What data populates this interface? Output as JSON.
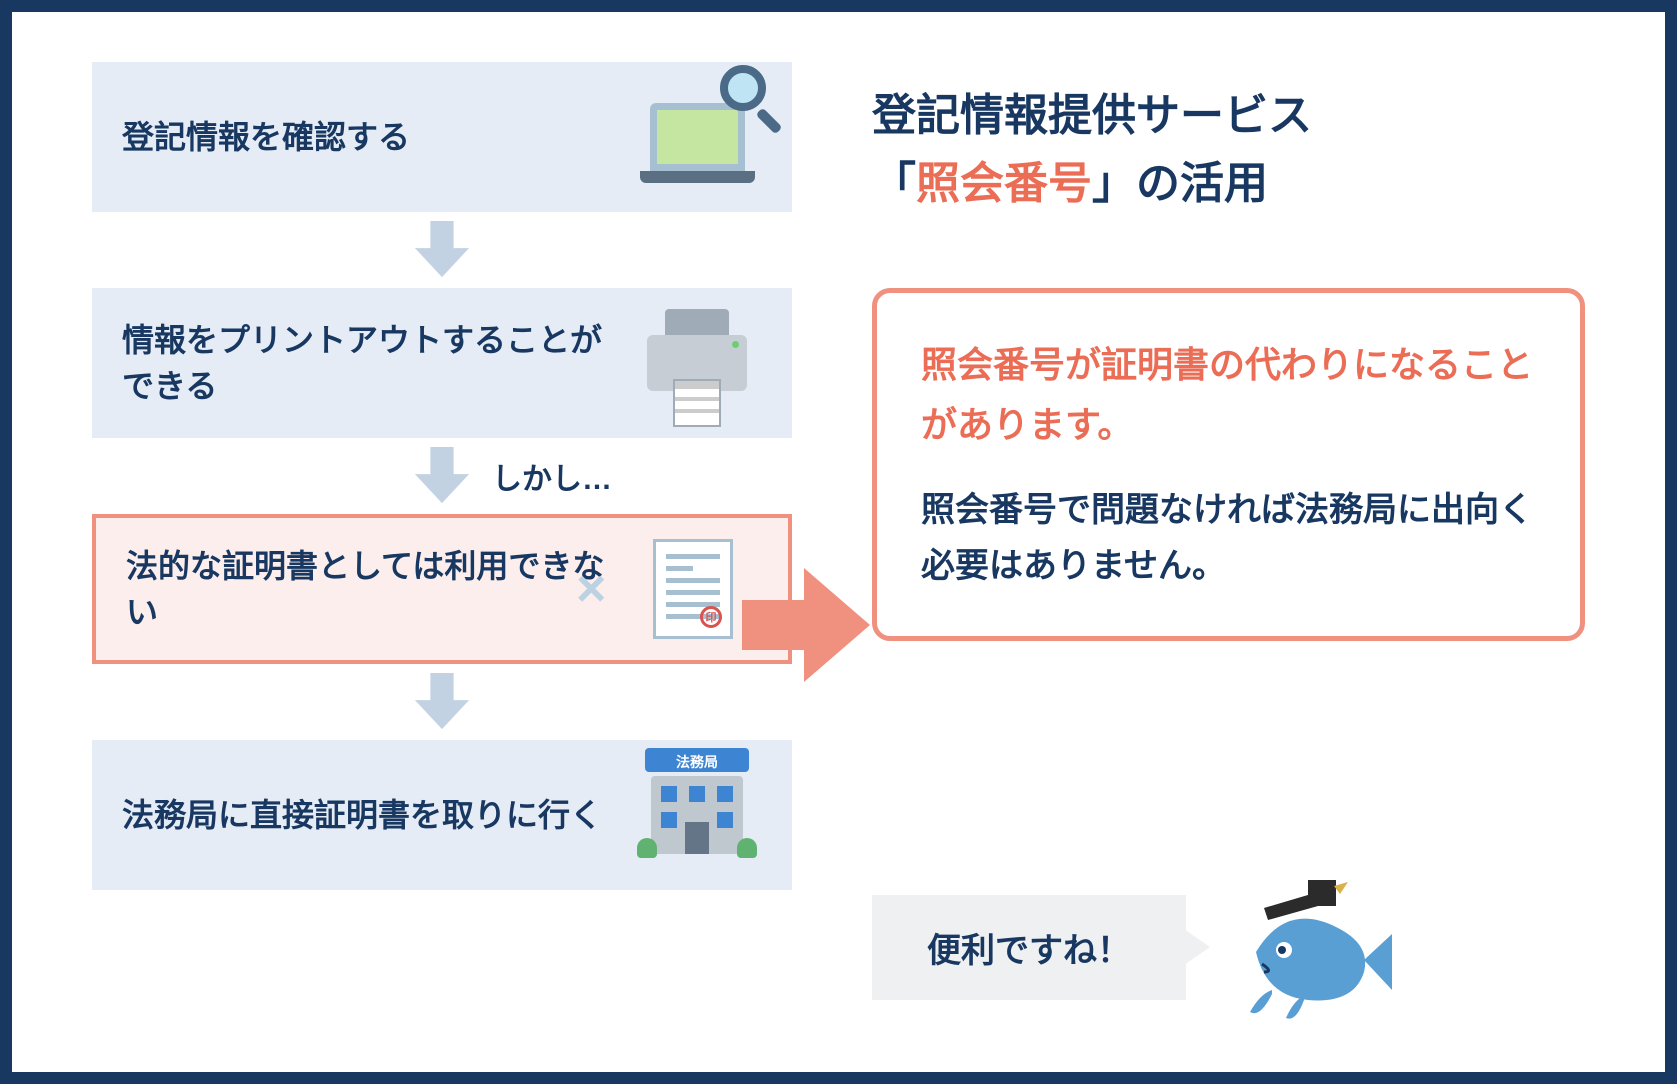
{
  "title_line1": "登記情報提供サービス",
  "title_prefix": "「",
  "title_highlight": "照会番号",
  "title_suffix": "」の活用",
  "steps": {
    "s1": "登記情報を確認する",
    "s2": "情報をプリントアウトすることができる",
    "s3": "法的な証明書としては利用できない",
    "s4": "法務局に直接証明書を取りに行く"
  },
  "however": "しかし…",
  "callout": {
    "p1": "照会番号が証明書の代わりになることがあります。",
    "p2": "照会番号で問題なければ法務局に出向く必要はありません。"
  },
  "speech": "便利ですね！",
  "building_label": "法務局",
  "seal_char": "印"
}
